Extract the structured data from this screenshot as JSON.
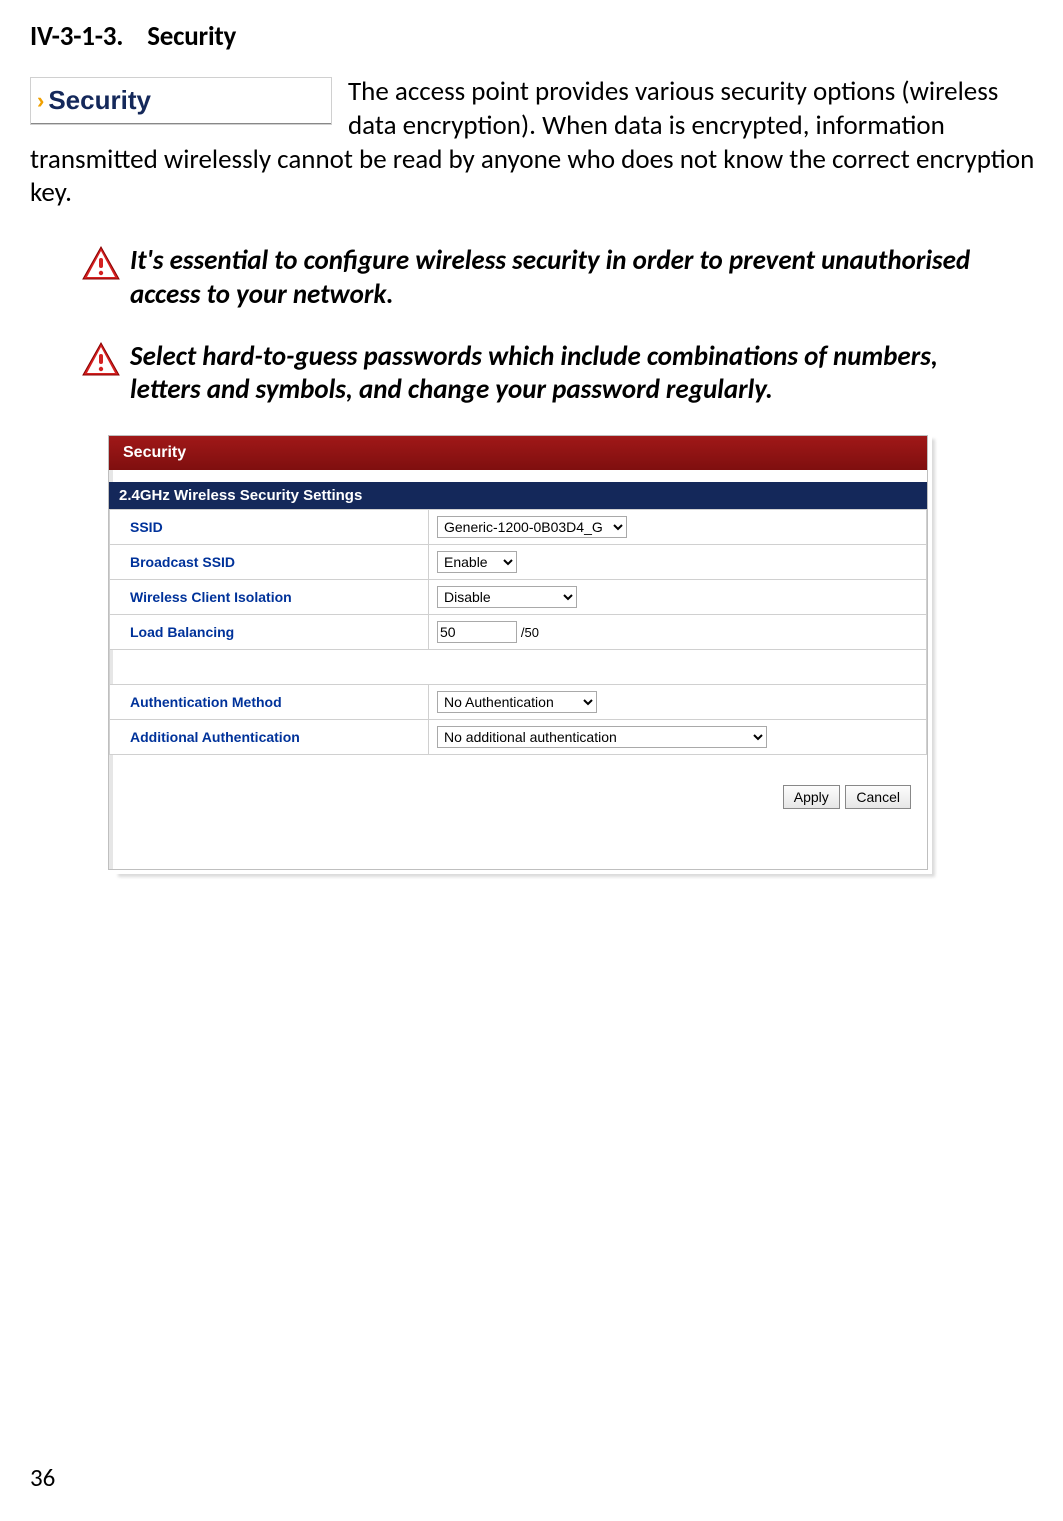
{
  "heading": {
    "number": "IV-3-1-3.",
    "title": "Security"
  },
  "menu_thumb": {
    "label": "Security"
  },
  "intro": "The access point provides various security options (wireless data encryption). When data is encrypted, information transmitted wirelessly cannot be read by anyone who does not know the correct encryption key.",
  "notes": [
    "It's essential to configure wireless security in order to prevent unauthorised access to your network.",
    "Select hard-to-guess passwords which include combinations of numbers, letters and symbols, and change your password regularly."
  ],
  "panel": {
    "title": "Security",
    "section": "2.4GHz Wireless Security Settings",
    "rows": {
      "ssid": {
        "label": "SSID",
        "value": "Generic-1200-0B03D4_G"
      },
      "broadcast": {
        "label": "Broadcast SSID",
        "value": "Enable"
      },
      "isolation": {
        "label": "Wireless Client Isolation",
        "value": "Disable"
      },
      "load": {
        "label": "Load Balancing",
        "value": "50",
        "suffix": "/50"
      },
      "auth": {
        "label": "Authentication Method",
        "value": "No Authentication"
      },
      "addauth": {
        "label": "Additional Authentication",
        "value": "No additional authentication"
      }
    },
    "buttons": {
      "apply": "Apply",
      "cancel": "Cancel"
    }
  },
  "page_number": "36"
}
